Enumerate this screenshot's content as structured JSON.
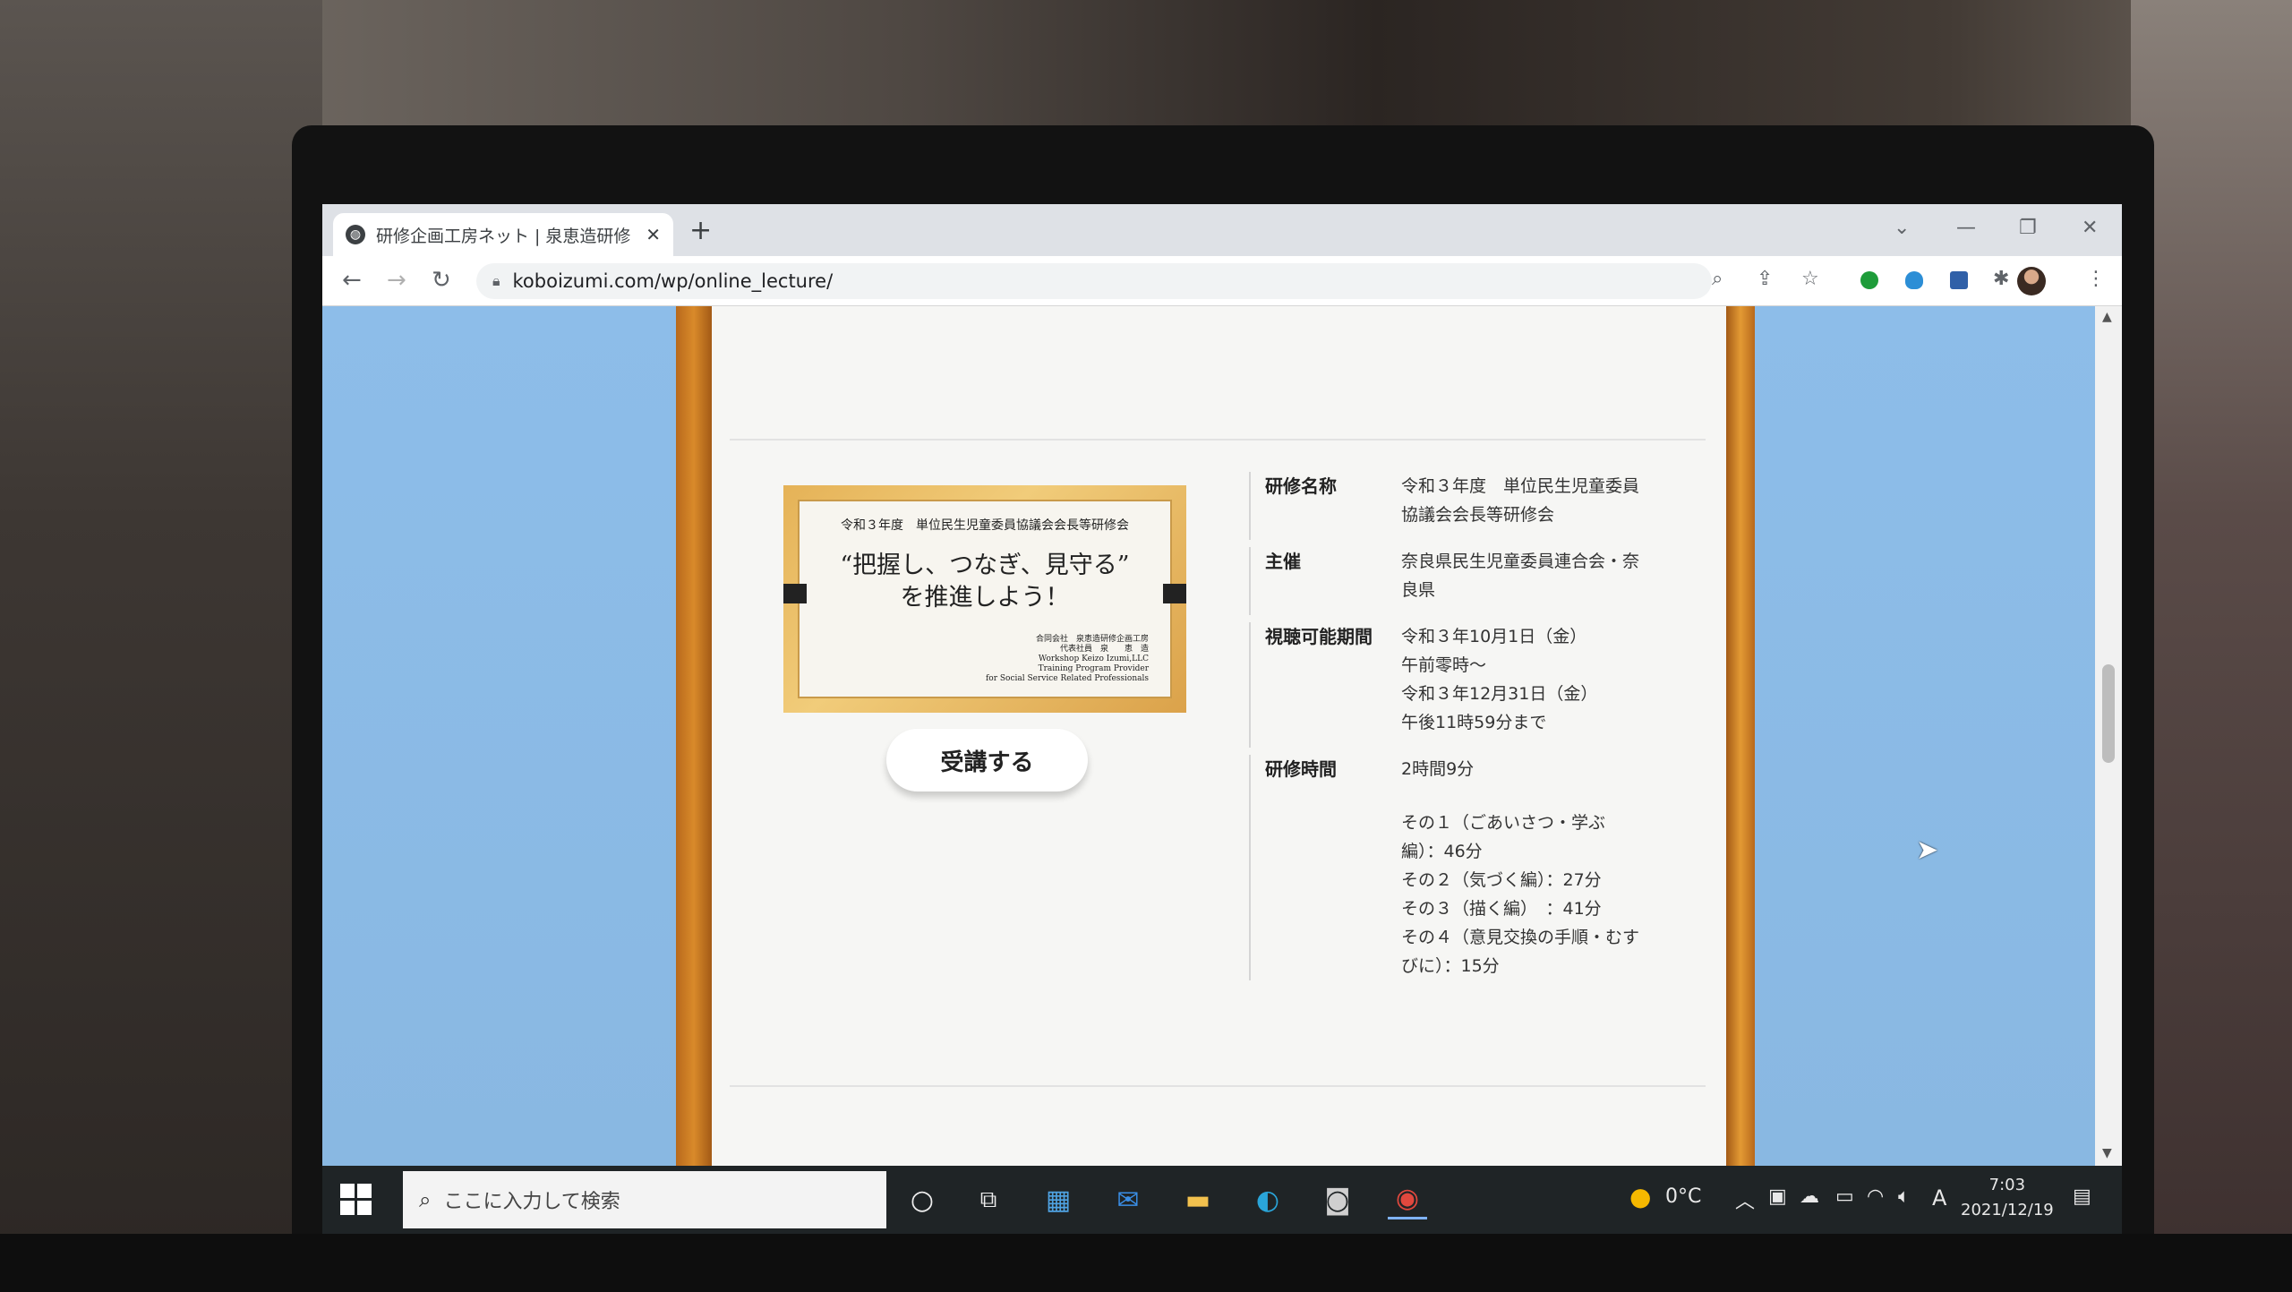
{
  "browser": {
    "tab_title": "研修企画工房ネット | 泉恵造研修",
    "tab_close": "✕",
    "new_tab": "+",
    "url": "koboizumi.com/wp/online_lecture/"
  },
  "page": {
    "thumbnail": {
      "top_line": "令和３年度　単位民生児童委員協議会会長等研修会",
      "main_line1": "“把握し、つなぎ、見守る”",
      "main_line2": "を推進しよう！",
      "foot1": "合同会社　泉恵造研修企画工房",
      "foot2": "代表社員　泉　　恵　造",
      "foot3": "Workshop Keizo Izumi,LLC",
      "foot4": "Training Program Provider",
      "foot5": "for Social Service Related Professionals"
    },
    "cta_label": "受講する",
    "info": [
      {
        "label": "研修名称",
        "lines": [
          "令和３年度　単位民生児童委員",
          "協議会会長等研修会"
        ]
      },
      {
        "label": "主催",
        "lines": [
          "奈良県民生児童委員連合会・奈",
          "良県"
        ]
      },
      {
        "label": "視聴可能期間",
        "lines": [
          "令和３年10月1日（金）",
          "午前零時～",
          "令和３年12月31日（金）",
          "午後11時59分まで"
        ]
      },
      {
        "label": "研修時間",
        "lines": [
          "2時間9分",
          "",
          "その１（ごあいさつ・学ぶ",
          "編）：46分",
          "その２（気づく編）：27分",
          "その３（描く編）　：41分",
          "その４（意見交換の手順・むす",
          "びに）：15分"
        ]
      }
    ]
  },
  "taskbar": {
    "search_placeholder": "ここに入力して検索",
    "weather": "0°C",
    "ime": "A",
    "time": "7:03",
    "date": "2021/12/19"
  },
  "colors": {
    "sky": "#8cbbe6",
    "wood": "#d98a2a",
    "paper": "#f6f6f4"
  }
}
